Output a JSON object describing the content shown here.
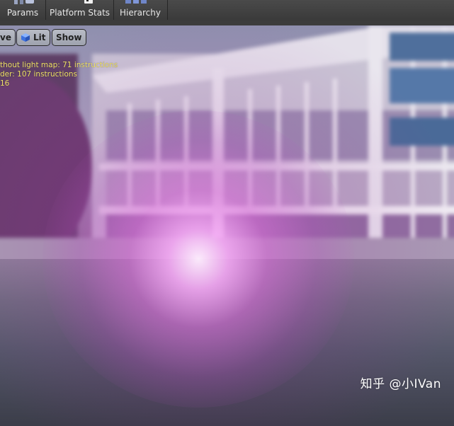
{
  "toolbar": {
    "buttons": [
      {
        "label": "Params",
        "icon": "params-icon"
      },
      {
        "label": "Platform Stats",
        "icon": "platform-stats-icon"
      },
      {
        "label": "Hierarchy",
        "icon": "hierarchy-icon"
      }
    ]
  },
  "viewport": {
    "view_button_label": "ve",
    "lit_button_label": "Lit",
    "show_button_label": "Show",
    "stats": [
      "thout light map: 71 instructions",
      "der: 107 instructions",
      "16"
    ]
  },
  "watermark": "知乎 @小IVan",
  "colors": {
    "stats_text": "#f2e36a",
    "glow": "#e8a0e8",
    "toolbar_bg": "#404040"
  }
}
